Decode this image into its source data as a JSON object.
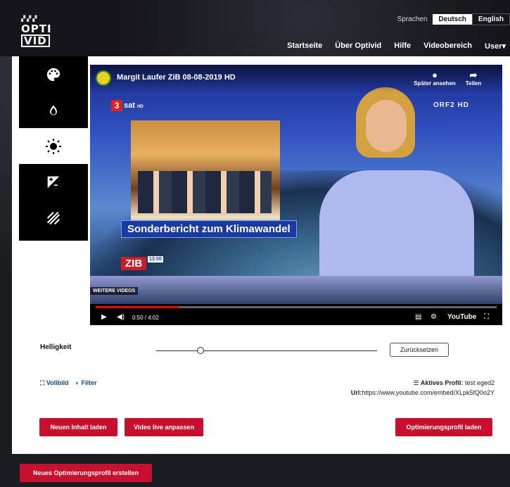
{
  "brand": {
    "line1": "OPTI",
    "line2": "VID"
  },
  "language": {
    "label": "Sprachen",
    "options": [
      "Deutsch",
      "English"
    ],
    "selected": "Deutsch"
  },
  "nav": [
    "Startseite",
    "Über Optivid",
    "Hilfe",
    "Videobereich",
    "User▾"
  ],
  "tools": [
    {
      "icon": "palette-icon",
      "glyph": "🎨"
    },
    {
      "icon": "drop-icon",
      "glyph": "💧"
    },
    {
      "icon": "brightness-icon",
      "glyph": "☀"
    },
    {
      "icon": "exposure-icon",
      "glyph": "◩"
    },
    {
      "icon": "hatch-icon",
      "glyph": "▨"
    }
  ],
  "active_tool": "brightness-icon",
  "video": {
    "title": "Margit Laufer ZiB 08-08-2019 HD",
    "watch_later": "Später ansehen",
    "share": "Teilen",
    "channel_num": "3",
    "channel_name": "sat",
    "channel_hd": "HD",
    "broadcaster": "ORF2 HD",
    "lower_third": "Sonderbericht zum Klimawandel",
    "show_logo": "ZIB",
    "show_time": "13:00",
    "more_videos": "WEITERE VIDEOS",
    "time": "0:50 / 4:02",
    "progress_fraction": 0.207,
    "youtube_label": "YouTube"
  },
  "controls": {
    "label": "Helligkeit",
    "slider_fraction": 0.2,
    "reset_label": "Zurücksetzen",
    "fullscreen_label": "Vollbild",
    "filter_label": "Filter"
  },
  "profile": {
    "active_label": "Aktives Profil:",
    "active_value": "test eged2",
    "url_label": "Url:",
    "url_value": "https://www.youtube.com/embed/XLpk5fQ0o2Y"
  },
  "buttons": {
    "load_content": "Neuen Inhalt laden",
    "live_adjust": "Video live anpassen",
    "load_profile": "Optimierungsprofil laden",
    "new_profile": "Neues Optimierungsprofil erstellen"
  },
  "colors": {
    "accent": "#c8102e",
    "link": "#1a4a80"
  }
}
